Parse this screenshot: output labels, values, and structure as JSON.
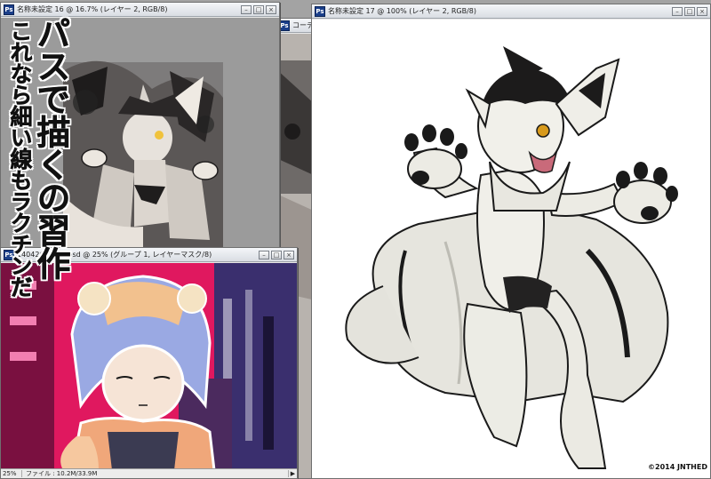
{
  "windows": {
    "top_left": {
      "title": "名称未設定 16 @ 16.7% (レイヤー 2, RGB/8)",
      "title_visible": "名称未設定 16",
      "title_zoom": "6.7% (レイヤー 2, RGB/8)"
    },
    "middle_behind": {
      "title": "コーデ"
    },
    "right": {
      "title": "名称未設定 17 @ 100% (レイヤー 2, RGB/8)",
      "copyright": "©2014 JNTHED"
    },
    "bottom_left": {
      "title": "140426_43 ... psd @ 25% (グループ 1, レイヤーマスク/8)",
      "title_left": "140426_43",
      "title_right": "psd @ 25% (グループ 1, レイヤーマスク/8)",
      "status_zoom": "25%",
      "status_info": "ファイル : 10.2M/33.9M"
    }
  },
  "overlay_text": {
    "main": "パスで描くの習作",
    "sub": "これなら細い線もラクチンだ"
  },
  "window_buttons": {
    "minimize": "–",
    "maximize": "□",
    "close": "×"
  },
  "icons": {
    "app": "Ps",
    "arrow": "▶"
  },
  "colors": {
    "desktop": "#a3a3a3",
    "title_gradient_top": "#f4f6f9",
    "ps_badge": "#1b3f8a",
    "magenta_art": "#e0185f"
  }
}
